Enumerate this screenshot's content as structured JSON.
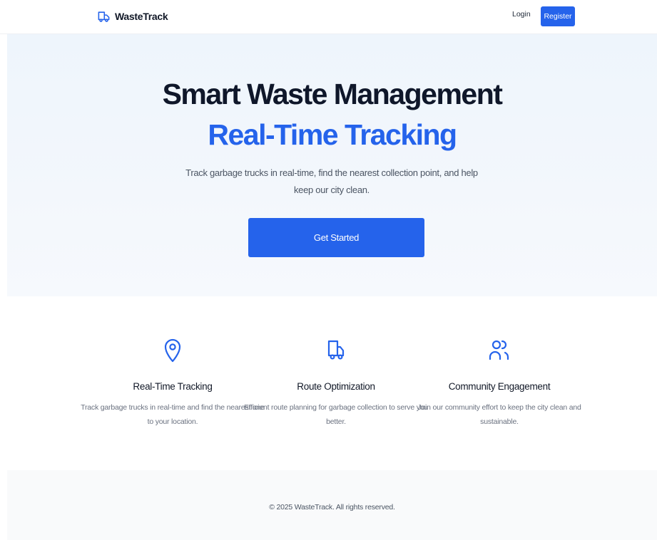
{
  "nav": {
    "brand": "WasteTrack",
    "brand_icon": "truck-icon",
    "login": "Login",
    "register": "Register"
  },
  "hero": {
    "title": "Smart Waste Management",
    "subtitle": "Real-Time Tracking",
    "description": "Track garbage trucks in real-time, find the nearest collection point, and help keep our city clean.",
    "cta": "Get Started"
  },
  "features": [
    {
      "icon": "map-pin-icon",
      "title": "Real-Time Tracking",
      "description": "Track garbage trucks in real-time and find the nearest one to your location."
    },
    {
      "icon": "truck-icon",
      "title": "Route Optimization",
      "description": "Efficient route planning for garbage collection to serve you better."
    },
    {
      "icon": "users-icon",
      "title": "Community Engagement",
      "description": "Join our community effort to keep the city clean and sustainable."
    }
  ],
  "footer": {
    "copyright": "© 2025 WasteTrack. All rights reserved."
  },
  "colors": {
    "accent": "#2563eb",
    "heading": "#0f172a",
    "muted": "#6b7280",
    "hero_bg": "#eef5fc",
    "footer_bg": "#f9fafb"
  }
}
